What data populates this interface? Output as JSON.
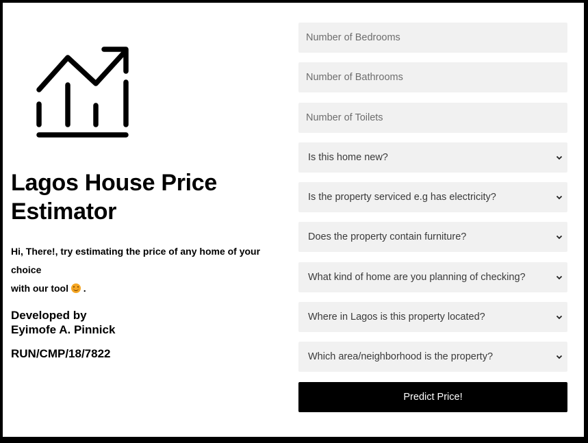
{
  "header": {
    "title_line1": "Lagos House Price",
    "title_line2": "Estimator",
    "intro_line1": "Hi, There!, try estimating the price of any home of your choice",
    "intro_line2": "with our tool",
    "intro_end": ".",
    "intro_emoji": "smiling-face"
  },
  "credits": {
    "developed_by": "Developed by",
    "author": "Eyimofe A. Pinnick",
    "reg_number": "RUN/CMP/18/7822"
  },
  "form": {
    "bedrooms_placeholder": "Number of Bedrooms",
    "bathrooms_placeholder": "Number of Bathrooms",
    "toilets_placeholder": "Number of Toilets",
    "selects": [
      {
        "label": "Is this home new?"
      },
      {
        "label": "Is the property serviced e.g has electricity?"
      },
      {
        "label": "Does the property contain furniture?"
      },
      {
        "label": "What kind of home are you planning of checking?"
      },
      {
        "label": "Where in Lagos is this property located?"
      },
      {
        "label": "Which area/neighborhood is the property?"
      }
    ],
    "submit_label": "Predict Price!"
  },
  "icons": {
    "logo": "trending-up-chart-icon",
    "select_arrow": "chevron-down-icon"
  },
  "colors": {
    "field_background": "#f1f1f1",
    "button_background": "#000000",
    "button_text": "#ffffff",
    "frame": "#000000"
  }
}
